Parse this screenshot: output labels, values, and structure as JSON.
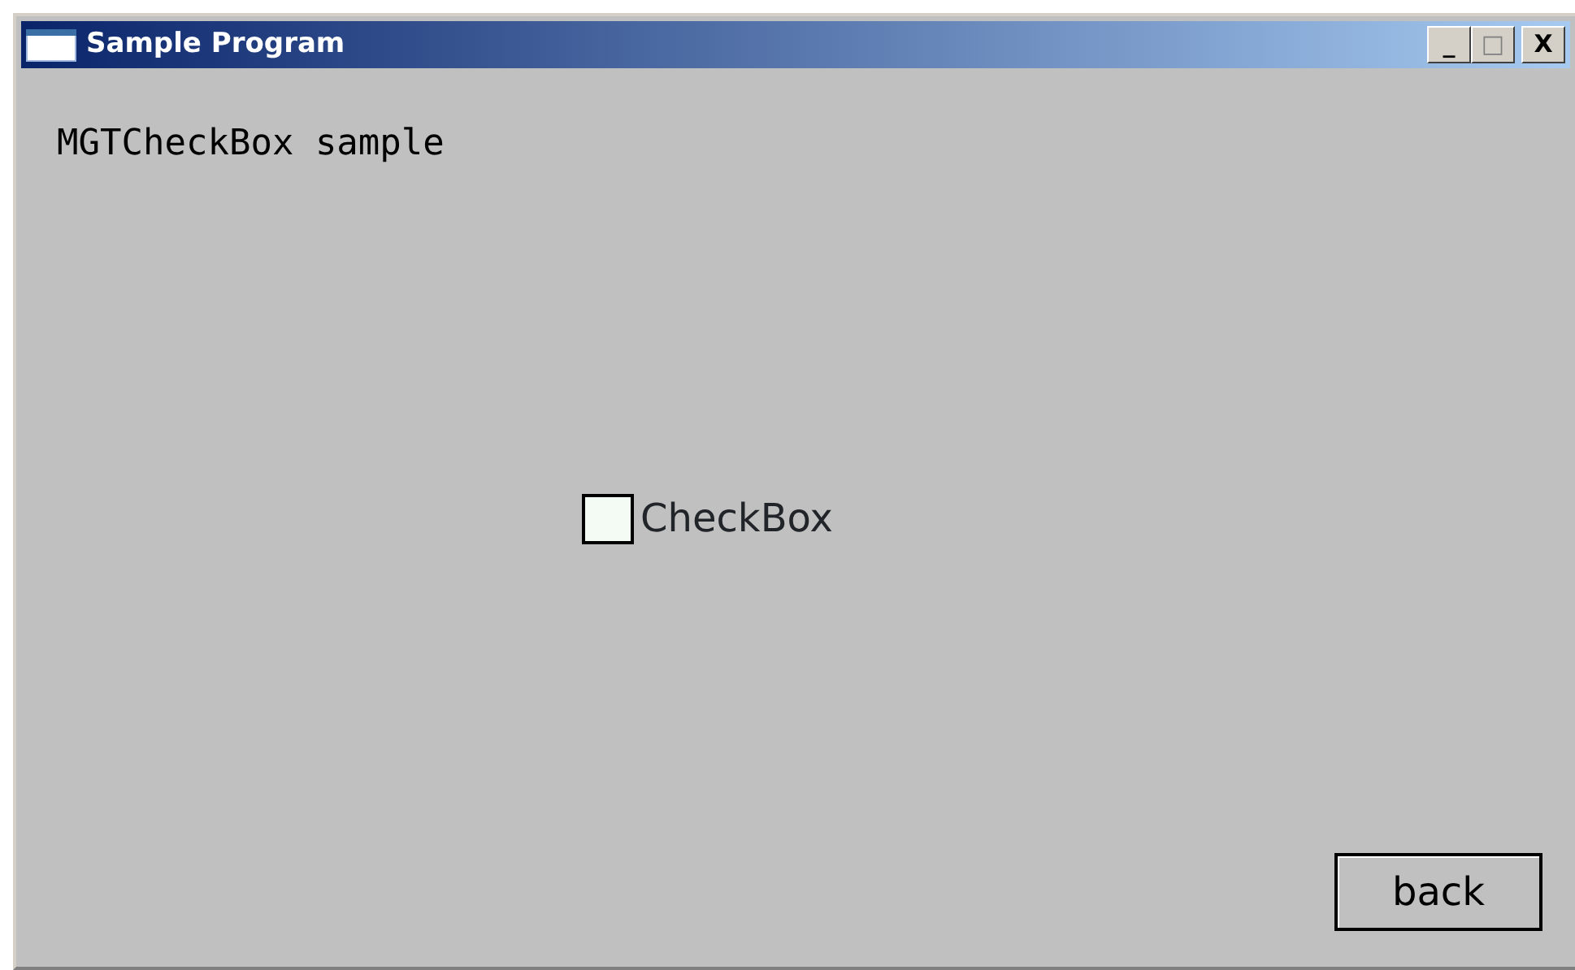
{
  "window": {
    "title": "Sample Program",
    "controls": [
      "_",
      "□",
      "X"
    ]
  },
  "heading": "MGTCheckBox sample",
  "checkbox": {
    "label": "CheckBox",
    "checked": false
  },
  "buttons": [
    "back"
  ]
}
